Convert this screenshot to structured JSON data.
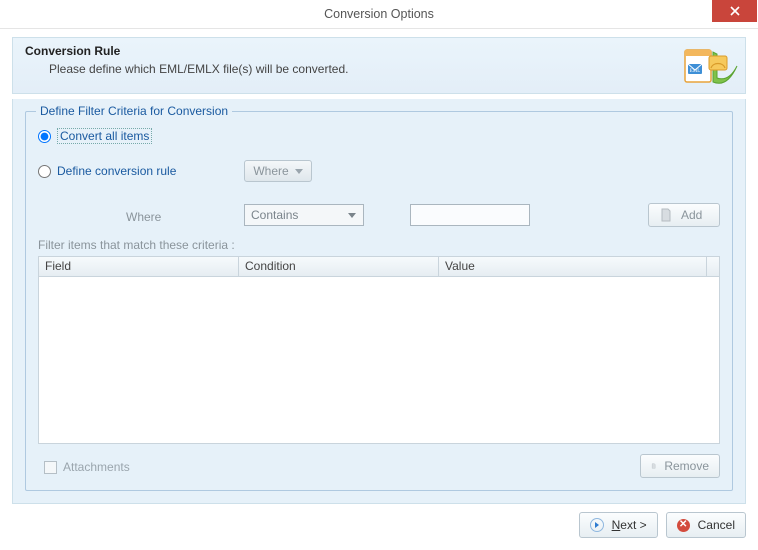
{
  "window": {
    "title": "Conversion Options"
  },
  "header": {
    "title": "Conversion Rule",
    "subtitle": "Please define which EML/EMLX file(s) will be converted."
  },
  "fieldset": {
    "legend": "Define Filter Criteria for Conversion",
    "radio_convert_all": "Convert all items",
    "radio_define_rule": "Define conversion rule",
    "where_button": "Where",
    "where_label": "Where",
    "condition_selected": "Contains",
    "value_text": "",
    "add_label": "Add",
    "hint": "Filter items that match these criteria :",
    "columns": {
      "field": "Field",
      "condition": "Condition",
      "value": "Value"
    },
    "attachments_label": "Attachments",
    "remove_label": "Remove"
  },
  "footer": {
    "next_label": "Next >",
    "cancel_label": "Cancel"
  }
}
